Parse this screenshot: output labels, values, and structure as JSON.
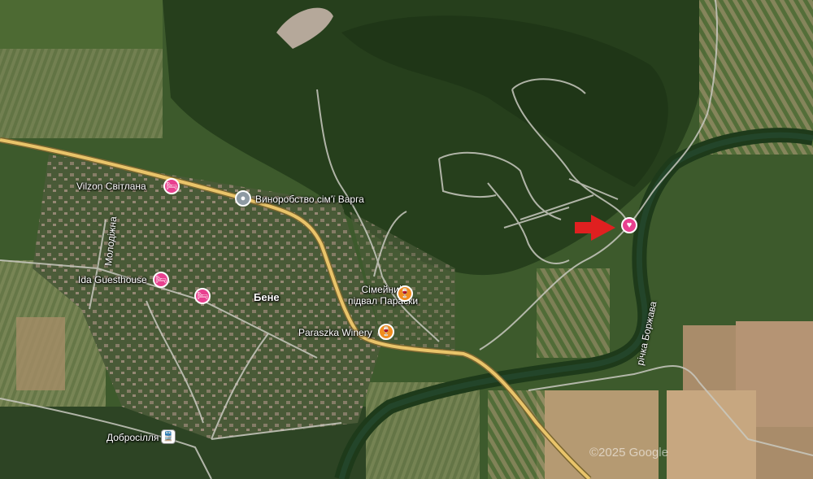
{
  "map": {
    "labels": {
      "vilzon": "Vilzon Світлана",
      "winery_varga": "Винороб­ство сім'ї Варга",
      "ida": "Ida Guesthouse",
      "bene": "Бене",
      "cellar_l1": "Сімейний",
      "cellar_l2": "підвал Параски",
      "paraszka": "Paraszka Winery",
      "dobrosillia": "Добросілля",
      "street": "Молодіжна",
      "river": "річка Боржава",
      "watermark": "©2025 Google"
    },
    "icons": {
      "hotel": "bed-icon",
      "winery": "glass-icon",
      "place": "dot-icon",
      "favorite": "heart-icon",
      "station": "train-icon"
    },
    "colors": {
      "hotel_pin": "#e8408f",
      "food_pin": "#f08c1e",
      "place_pin": "#8e9aa3",
      "main_road": "#e9c46a",
      "arrow": "#e02020"
    }
  }
}
